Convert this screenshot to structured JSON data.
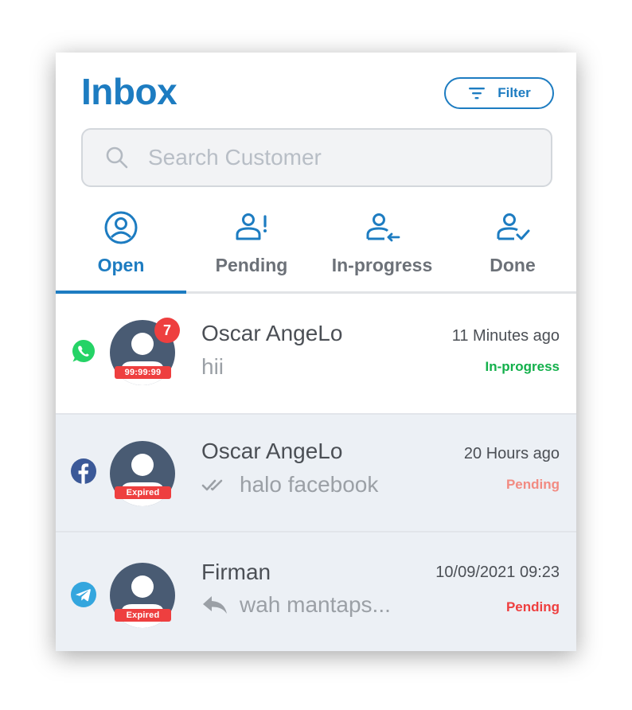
{
  "header": {
    "title": "Inbox",
    "filter_label": "Filter"
  },
  "search": {
    "placeholder": "Search Customer",
    "value": ""
  },
  "tabs": [
    {
      "label": "Open",
      "icon": "user-circle-icon",
      "active": true
    },
    {
      "label": "Pending",
      "icon": "user-alert-icon",
      "active": false
    },
    {
      "label": "In-progress",
      "icon": "user-arrow-icon",
      "active": false
    },
    {
      "label": "Done",
      "icon": "user-check-icon",
      "active": false
    }
  ],
  "conversations": [
    {
      "channel": "whatsapp-icon",
      "name": "Oscar AngeLo",
      "message": "hii",
      "time": "11 Minutes ago",
      "status": "In-progress",
      "status_color": "#13b04b",
      "tag": "99:99:99",
      "unread": "7"
    },
    {
      "channel": "facebook-icon",
      "name": "Oscar AngeLo",
      "message": "halo facebook",
      "message_icon": "double-check-icon",
      "time": "20 Hours ago",
      "status": "Pending",
      "status_color": "#f28b82",
      "tag": "Expired"
    },
    {
      "channel": "telegram-icon",
      "name": "Firman",
      "message": "wah mantaps...",
      "message_icon": "reply-icon",
      "time": "10/09/2021 09:23",
      "status": "Pending",
      "status_color": "#ee3f3f",
      "tag": "Expired"
    }
  ],
  "colors": {
    "primary": "#1d7cc1",
    "badge": "#ee3f3f",
    "avatar": "#495b73",
    "row_alt": "#ecf0f5"
  }
}
